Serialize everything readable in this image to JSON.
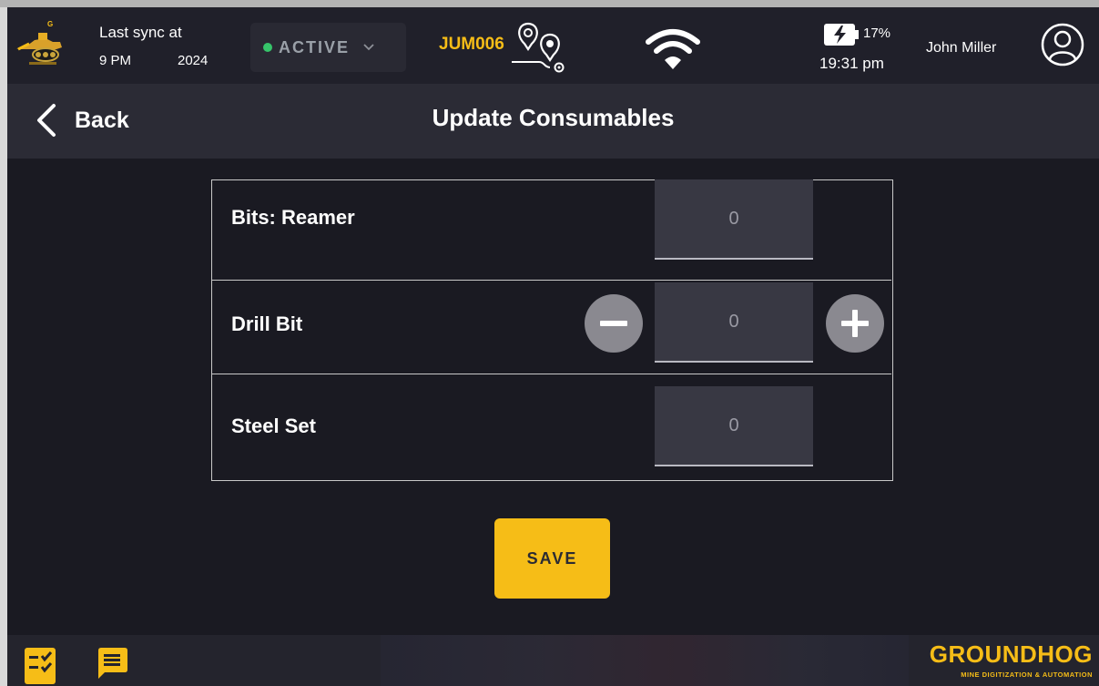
{
  "status_bar": {
    "logo_icon": "drill-rig-logo-icon",
    "sync_title": "Last sync at",
    "sync_time": "9 PM",
    "sync_year": "2024",
    "status": {
      "label": "ACTIVE",
      "dot_color": "#36c46a",
      "icon": "chevron-down-icon"
    },
    "machine_id": "JUM006",
    "route_icon": "route-pins-icon",
    "wifi_icon": "wifi-icon",
    "battery": {
      "icon": "battery-charging-icon",
      "percent": "17%"
    },
    "time": "19:31 pm",
    "user_name": "John Miller",
    "avatar_icon": "user-avatar-icon"
  },
  "header": {
    "back_label": "Back",
    "back_icon": "chevron-left-icon",
    "title": "Update Consumables"
  },
  "consumables": [
    {
      "label": "Bits: Reamer",
      "value": "0",
      "has_stepper": false
    },
    {
      "label": "Drill Bit",
      "value": "0",
      "has_stepper": true
    },
    {
      "label": "Steel Set",
      "value": "0",
      "has_stepper": false
    }
  ],
  "stepper": {
    "decrement_icon": "minus-icon",
    "increment_icon": "plus-icon"
  },
  "save_label": "SAVE",
  "footer": {
    "checklist_icon": "checklist-icon",
    "chat_icon": "chat-icon",
    "brand": "GROUNDHOG",
    "tagline": "MINE DIGITIZATION & AUTOMATION"
  },
  "colors": {
    "accent": "#f6bd17",
    "background": "#1a1a22",
    "header": "#2b2b35",
    "field": "#383843",
    "stepper": "#8a8990"
  }
}
